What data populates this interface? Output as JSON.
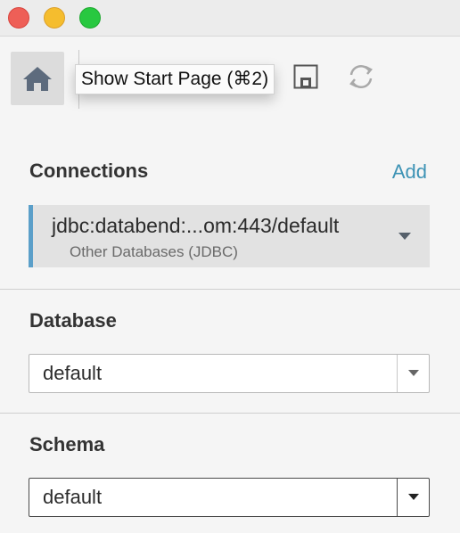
{
  "window": {
    "traffic_lights": [
      "close",
      "minimize",
      "zoom"
    ]
  },
  "toolbar": {
    "home_icon": "home-icon",
    "tooltip": "Show Start Page (⌘2)",
    "save_icon": "save-icon",
    "refresh_icon": "refresh-icon"
  },
  "connections": {
    "title": "Connections",
    "add_label": "Add",
    "items": [
      {
        "name": "jdbc:databend:...om:443/default",
        "type": "Other Databases (JDBC)"
      }
    ]
  },
  "database": {
    "title": "Database",
    "selected": "default"
  },
  "schema": {
    "title": "Schema",
    "selected": "default"
  },
  "colors": {
    "accent": "#3d93b5",
    "connection_indicator": "#5b9fc9"
  }
}
